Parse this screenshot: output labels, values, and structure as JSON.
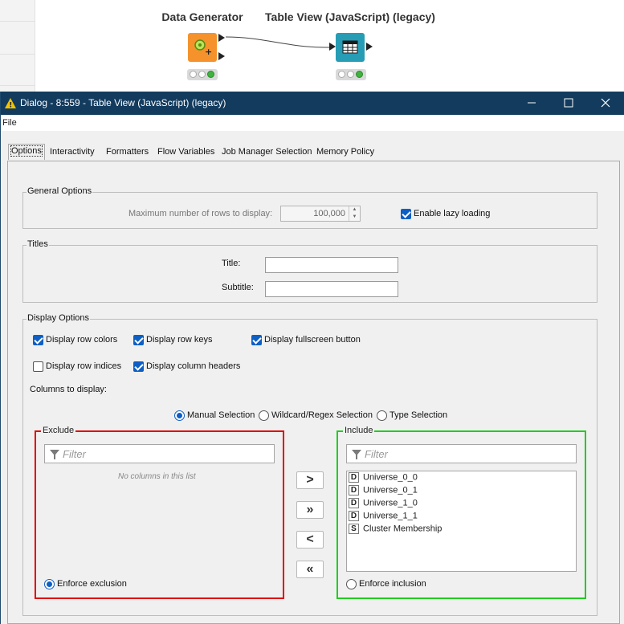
{
  "workflow": {
    "nodes": [
      {
        "title": "Data Generator",
        "icon": "data-generator-icon",
        "color": "#f5922b"
      },
      {
        "title": "Table View (JavaScript) (legacy)",
        "icon": "table-view-icon",
        "color": "#279cb5"
      }
    ],
    "status_ok_color": "#3fb23f"
  },
  "dialog": {
    "title": "Dialog - 8:559 - Table View (JavaScript) (legacy)",
    "menu": {
      "file": "File"
    },
    "tabs": [
      "Options",
      "Interactivity",
      "Formatters",
      "Flow Variables",
      "Job Manager Selection",
      "Memory Policy"
    ],
    "general": {
      "legend": "General Options",
      "max_rows_label": "Maximum number of rows to display:",
      "max_rows_value": "100,000",
      "lazy_loading_label": "Enable lazy loading",
      "lazy_loading_checked": true
    },
    "titles": {
      "legend": "Titles",
      "title_label": "Title:",
      "title_value": "",
      "subtitle_label": "Subtitle:",
      "subtitle_value": ""
    },
    "display": {
      "legend": "Display Options",
      "row_colors": "Display row colors",
      "row_keys": "Display row keys",
      "fullscreen_button": "Display fullscreen button",
      "row_indices": "Display row indices",
      "column_headers": "Display column headers",
      "columns_to_display": "Columns to display:",
      "selection_modes": [
        "Manual Selection",
        "Wildcard/Regex Selection",
        "Type Selection"
      ],
      "selected_mode": "Manual Selection"
    },
    "exclude": {
      "legend": "Exclude",
      "filter_placeholder": "Filter",
      "empty_message": "No columns in this list",
      "enforce_label": "Enforce exclusion",
      "border_color": "#e00000"
    },
    "include": {
      "legend": "Include",
      "filter_placeholder": "Filter",
      "enforce_label": "Enforce inclusion",
      "border_color": "#22cc22",
      "columns": [
        {
          "type": "D",
          "name": "Universe_0_0"
        },
        {
          "type": "D",
          "name": "Universe_0_1"
        },
        {
          "type": "D",
          "name": "Universe_1_0"
        },
        {
          "type": "D",
          "name": "Universe_1_1"
        },
        {
          "type": "S",
          "name": "Cluster Membership"
        }
      ]
    },
    "move_buttons": [
      ">",
      "»",
      "<",
      "«"
    ],
    "accent_color": "#0d5fc4",
    "titlebar_color": "#123b5e"
  }
}
